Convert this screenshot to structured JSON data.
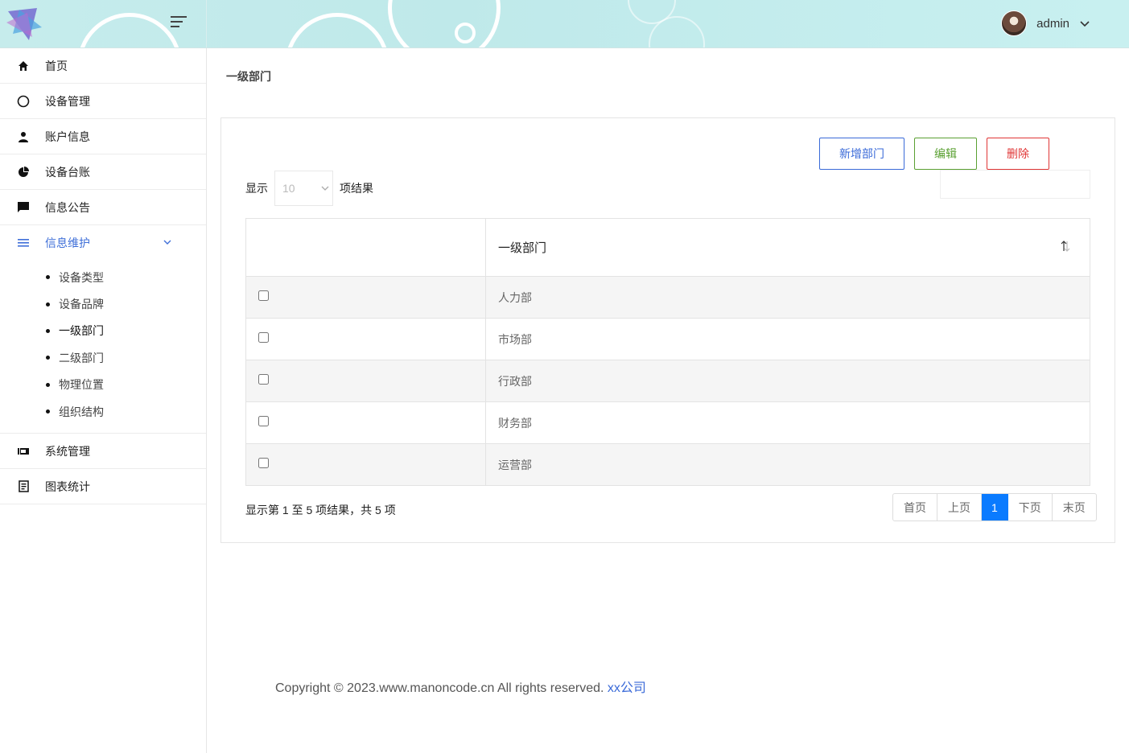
{
  "header": {
    "username": "admin"
  },
  "sidebar": {
    "items": [
      {
        "label": "首页",
        "icon": "home-icon"
      },
      {
        "label": "设备管理",
        "icon": "circle-icon"
      },
      {
        "label": "账户信息",
        "icon": "user-icon"
      },
      {
        "label": "设备台账",
        "icon": "pie-chart-icon"
      },
      {
        "label": "信息公告",
        "icon": "message-icon"
      },
      {
        "label": "信息维护",
        "icon": "list-icon",
        "expanded": true
      },
      {
        "label": "系统管理",
        "icon": "ticket-icon"
      },
      {
        "label": "图表统计",
        "icon": "document-icon"
      }
    ],
    "submenu": [
      "设备类型",
      "设备品牌",
      "一级部门",
      "二级部门",
      "物理位置",
      "组织结构"
    ],
    "current_submenu": "一级部门"
  },
  "page": {
    "title": "一级部门"
  },
  "toolbar": {
    "add_label": "新增部门",
    "edit_label": "编辑",
    "delete_label": "删除"
  },
  "length": {
    "prefix": "显示",
    "value": "10",
    "suffix": "项结果"
  },
  "table": {
    "column_header": "一级部门",
    "rows": [
      "人力部",
      "市场部",
      "行政部",
      "财务部",
      "运营部"
    ]
  },
  "info_text": "显示第 1 至 5 项结果，共 5 项",
  "pagination": {
    "first": "首页",
    "prev": "上页",
    "current": "1",
    "next": "下页",
    "last": "末页"
  },
  "footer": {
    "text": "Copyright © 2023.www.manoncode.cn All rights reserved. ",
    "link": "xx公司"
  },
  "colors": {
    "accent": "#3a6ad8",
    "success": "#5aa032",
    "danger": "#e03535",
    "page_active": "#0a7bff",
    "header_bg": "#c6ecec"
  }
}
